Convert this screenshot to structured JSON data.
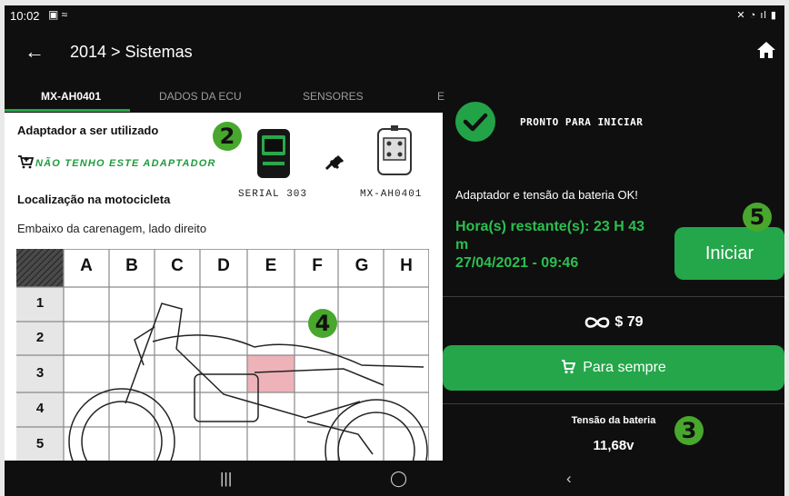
{
  "status": {
    "time": "10:02"
  },
  "appbar": {
    "breadcrumb": "2014 > Sistemas"
  },
  "tabs": [
    {
      "label": "MX-AH0401"
    },
    {
      "label": "DADOS DA ECU"
    },
    {
      "label": "SENSORES"
    },
    {
      "label": "E"
    }
  ],
  "left": {
    "adapter_title": "Adaptador a ser utilizado",
    "no_adapter_link": "NÃO TENHO ESTE ADAPTADOR",
    "adapter_serial": "SERIAL 303",
    "adapter_model": "MX-AH0401",
    "location_title": "Localização na motocicleta",
    "location_value": "Embaixo da carenagem, lado direito",
    "grid": {
      "columns": [
        "A",
        "B",
        "C",
        "D",
        "E",
        "F",
        "G",
        "H"
      ],
      "rows": [
        "1",
        "2",
        "3",
        "4",
        "5"
      ],
      "highlight": "E3"
    }
  },
  "right": {
    "ready_title": "PRONTO PARA INICIAR",
    "message": "Adaptador e tensão da bateria OK!",
    "hours_line1": "Hora(s) restante(s): 23 H 43",
    "hours_line2": "m",
    "hours_line3": "27/04/2021 - 09:46",
    "start_label": "Iniciar",
    "price": "$ 79",
    "buy_label": "Para sempre",
    "battery_label": "Tensão da bateria",
    "battery_value": "11,68v"
  },
  "badges": {
    "b2": "2",
    "b3": "3",
    "b4": "4",
    "b5": "5"
  },
  "colors": {
    "accent": "#25a548",
    "badge": "#48a72d",
    "highlight": "#e8a0a8"
  }
}
